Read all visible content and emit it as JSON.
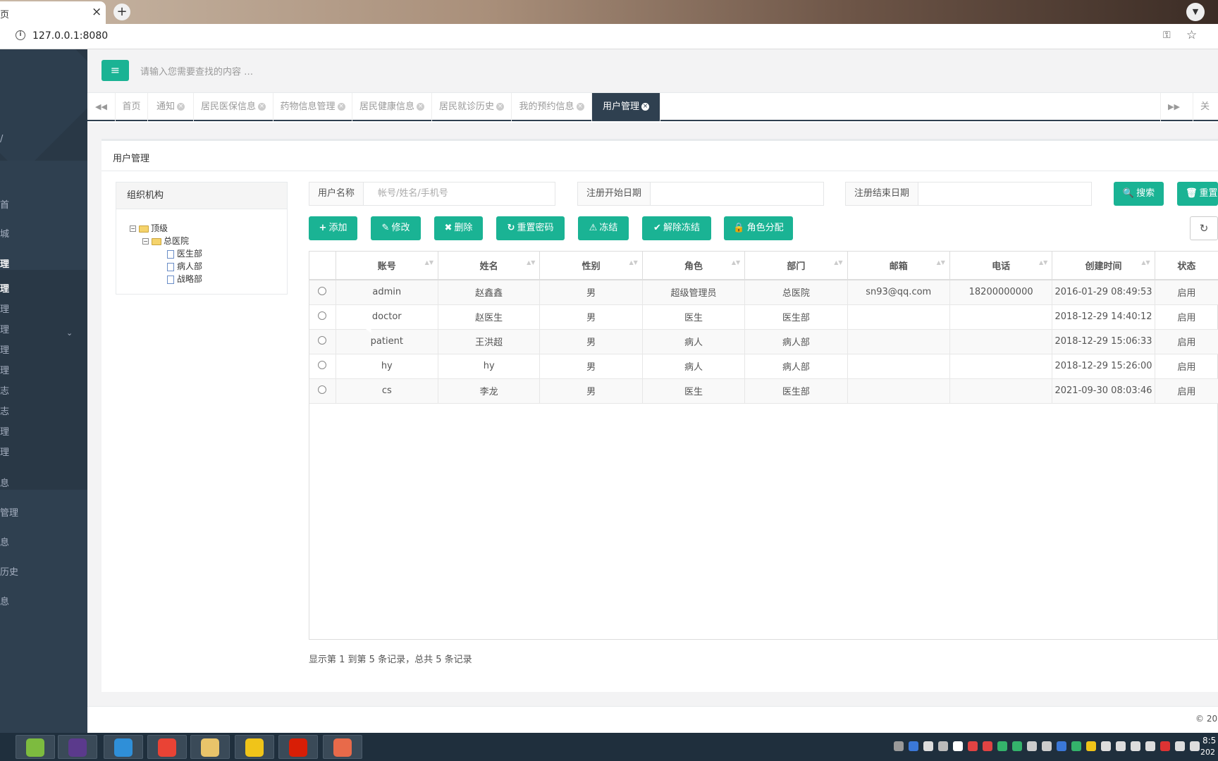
{
  "browser": {
    "tab_title": "页",
    "close_glyph": "×",
    "new_tab_glyph": "+",
    "url": "127.0.0.1:8080",
    "info_glyph": "i",
    "profile_glyph": "▼"
  },
  "sidebar": {
    "top_chevron": "/",
    "items": [
      {
        "label": "首",
        "state": "normal"
      },
      {
        "label": "城",
        "state": "normal"
      },
      {
        "label": "理",
        "state": "group-open"
      },
      {
        "label": "理",
        "state": "active"
      },
      {
        "label": "理",
        "state": "normal"
      },
      {
        "label": "理",
        "state": "normal"
      },
      {
        "label": "理",
        "state": "normal"
      },
      {
        "label": "理",
        "state": "normal"
      },
      {
        "label": "志",
        "state": "normal"
      },
      {
        "label": "志",
        "state": "normal"
      },
      {
        "label": "理",
        "state": "normal"
      },
      {
        "label": "理",
        "state": "normal"
      },
      {
        "label": "息",
        "state": "normal"
      },
      {
        "label": "管理",
        "state": "normal"
      },
      {
        "label": "息",
        "state": "normal"
      },
      {
        "label": "历史",
        "state": "normal"
      },
      {
        "label": "息",
        "state": "normal"
      }
    ],
    "chevron_glyph": "⌄"
  },
  "header": {
    "menu_glyph": "≡",
    "search_placeholder": "请输入您需要查找的内容 …"
  },
  "tabs": {
    "left_glyph": "◀◀",
    "right_glyph": "▶▶",
    "close_all_label": "关闭操",
    "items": [
      {
        "label": "首页",
        "closable": false,
        "active": false
      },
      {
        "label": "通知",
        "closable": true,
        "active": false
      },
      {
        "label": "居民医保信息",
        "closable": true,
        "active": false
      },
      {
        "label": "药物信息管理",
        "closable": true,
        "active": false
      },
      {
        "label": "居民健康信息",
        "closable": true,
        "active": false
      },
      {
        "label": "居民就诊历史",
        "closable": true,
        "active": false
      },
      {
        "label": "我的预约信息",
        "closable": true,
        "active": false
      },
      {
        "label": "用户管理",
        "closable": true,
        "active": true
      }
    ],
    "close_glyph": "×"
  },
  "panel": {
    "title": "用户管理",
    "org_title": "组织机构",
    "tree": [
      {
        "label": "顶级",
        "level": 0,
        "type": "folder"
      },
      {
        "label": "总医院",
        "level": 1,
        "type": "folder"
      },
      {
        "label": "医生部",
        "level": 2,
        "type": "file"
      },
      {
        "label": "病人部",
        "level": 2,
        "type": "file"
      },
      {
        "label": "战略部",
        "level": 2,
        "type": "file"
      }
    ],
    "tree_toggle_glyph": "−"
  },
  "filters": {
    "username_label": "用户名称",
    "username_placeholder": "帐号/姓名/手机号",
    "start_label": "注册开始日期",
    "start_value": "",
    "end_label": "注册结束日期",
    "end_value": "",
    "search_label": "搜索",
    "reset_label": "重置",
    "search_glyph": "🔍",
    "reset_glyph": "🗑"
  },
  "toolbar": {
    "add": {
      "glyph": "+",
      "label": "添加"
    },
    "edit": {
      "glyph": "✎",
      "label": "修改"
    },
    "delete": {
      "glyph": "✖",
      "label": "删除"
    },
    "reset_pwd": {
      "glyph": "↻",
      "label": "重置密码"
    },
    "freeze": {
      "glyph": "⚠",
      "label": "冻结"
    },
    "unfreeze": {
      "glyph": "✔",
      "label": "解除冻结"
    },
    "assign_role": {
      "glyph": "🔒",
      "label": "角色分配"
    },
    "refresh_glyph": "↻"
  },
  "table": {
    "columns": [
      "账号",
      "姓名",
      "性别",
      "角色",
      "部门",
      "邮箱",
      "电话",
      "创建时间",
      "状态"
    ],
    "sort_glyph": "▲▼",
    "rows": [
      [
        "admin",
        "赵鑫鑫",
        "男",
        "超级管理员",
        "总医院",
        "sn93@qq.com",
        "18200000000",
        "2016-01-29 08:49:53",
        "启用"
      ],
      [
        "doctor",
        "赵医生",
        "男",
        "医生",
        "医生部",
        "",
        "",
        "2018-12-29 14:40:12",
        "启用"
      ],
      [
        "patient",
        "王洪超",
        "男",
        "病人",
        "病人部",
        "",
        "",
        "2018-12-29 15:06:33",
        "启用"
      ],
      [
        "hy",
        "hy",
        "男",
        "病人",
        "病人部",
        "",
        "",
        "2018-12-29 15:26:00",
        "启用"
      ],
      [
        "cs",
        "李龙",
        "男",
        "医生",
        "医生部",
        "",
        "",
        "2021-09-30 08:03:46",
        "启用"
      ]
    ]
  },
  "pager": {
    "text": "显示第 1 到第 5 条记录，总共 5 条记录"
  },
  "footer": {
    "copyright": "© 20"
  },
  "taskbar": {
    "apps": [
      {
        "name": "notepad-app",
        "color": "#7dbb3f"
      },
      {
        "name": "eclipse-app",
        "color": "#5b3a8c"
      },
      {
        "name": "feishu-app",
        "color": "#2f8fd8"
      },
      {
        "name": "chrome-app",
        "color": "#e94335"
      },
      {
        "name": "file-explorer-app",
        "color": "#e9c46a"
      },
      {
        "name": "duck-app",
        "color": "#f0c419"
      },
      {
        "name": "netease-music-app",
        "color": "#d81e06"
      },
      {
        "name": "camera-app",
        "color": "#e86a4a"
      }
    ],
    "clock_time": "8:5",
    "clock_date": "202"
  },
  "colors": {
    "accent": "#1ab394",
    "sidebar": "#2f4050",
    "active_tab": "#2f4050"
  }
}
